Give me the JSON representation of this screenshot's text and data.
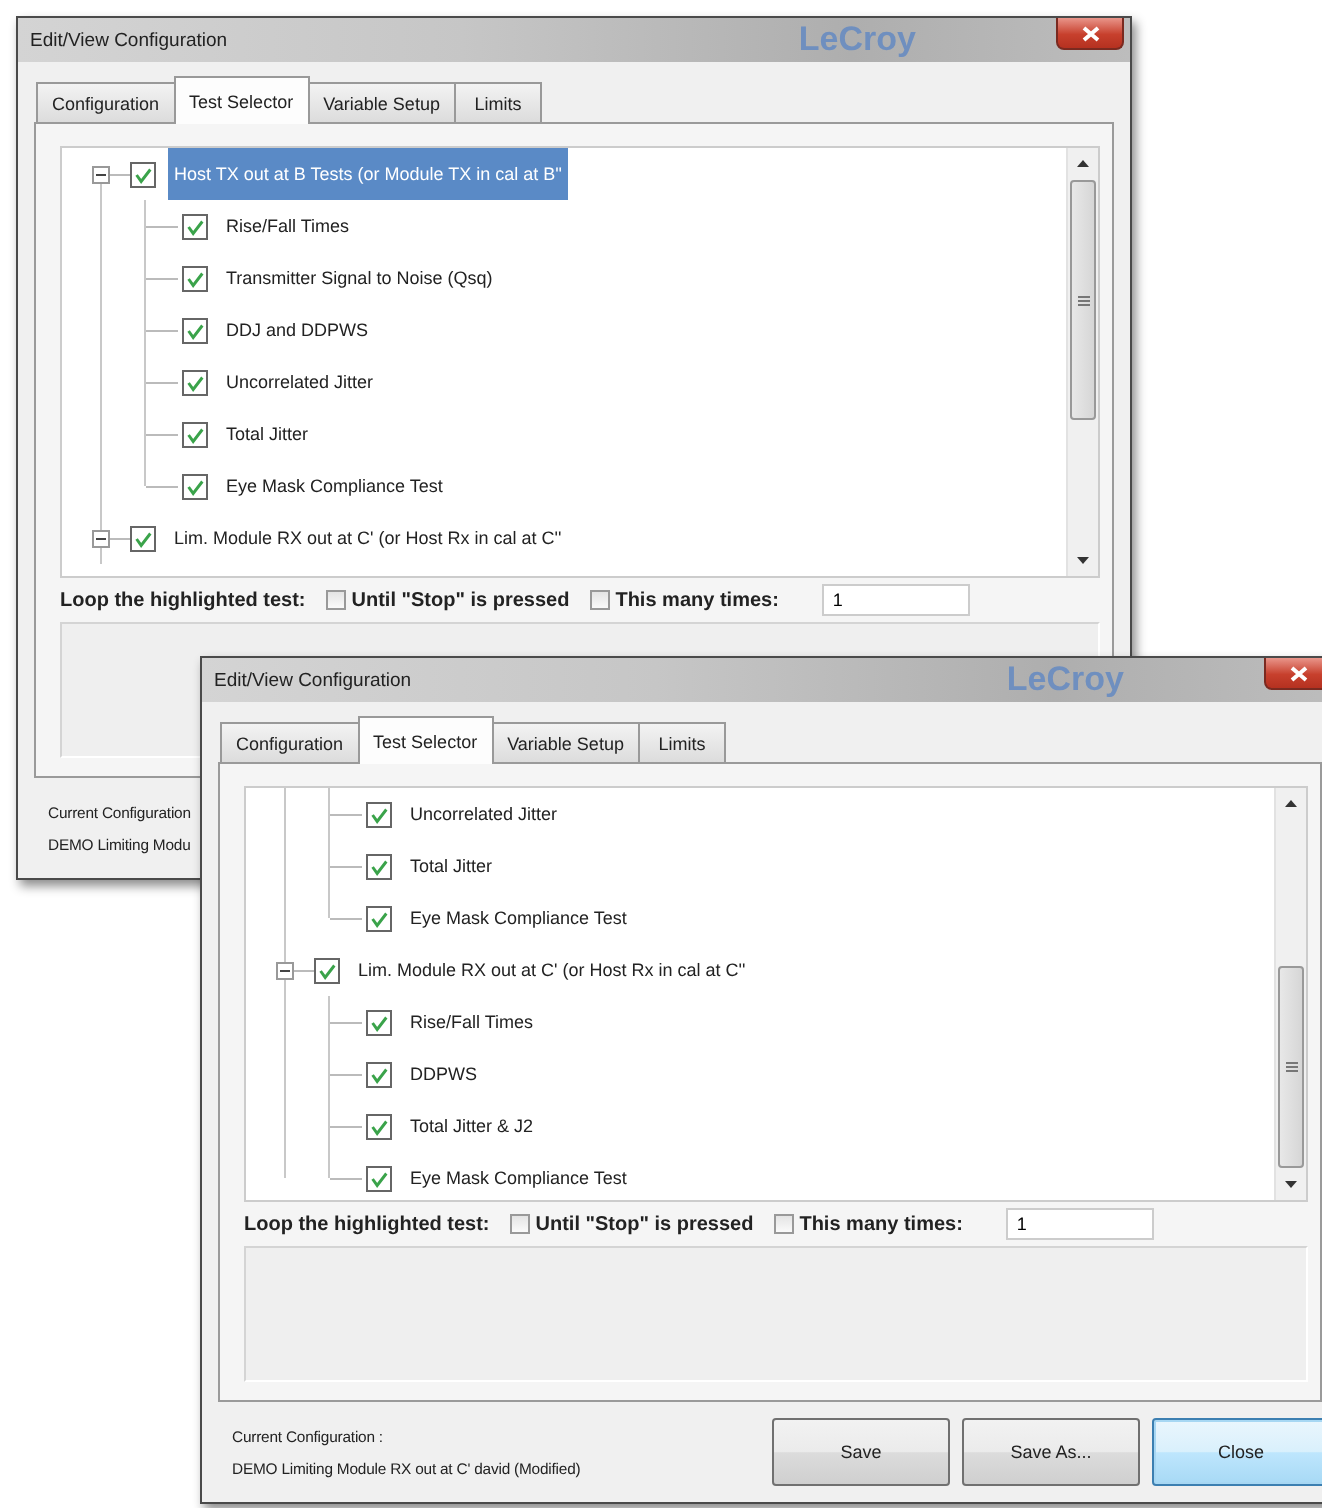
{
  "windows": [
    {
      "title": "Edit/View Configuration",
      "logo": "LeCroy",
      "tabs": [
        {
          "label": "Configuration",
          "selected": false
        },
        {
          "label": "Test Selector",
          "selected": true
        },
        {
          "label": "Variable Setup",
          "selected": false
        },
        {
          "label": "Limits",
          "selected": false
        }
      ],
      "tree": [
        {
          "label": "Host TX out at B Tests (or Module TX in cal at B''",
          "checked": true,
          "selected": true,
          "expanded": true,
          "children": [
            {
              "label": "Rise/Fall Times",
              "checked": true,
              "selected": false
            },
            {
              "label": "Transmitter Signal to Noise (Qsq)",
              "checked": true,
              "selected": false
            },
            {
              "label": "DDJ and DDPWS",
              "checked": true,
              "selected": false
            },
            {
              "label": "Uncorrelated Jitter",
              "checked": true,
              "selected": false
            },
            {
              "label": "Total Jitter",
              "checked": true,
              "selected": false
            },
            {
              "label": "Eye Mask Compliance Test",
              "checked": true,
              "selected": false
            }
          ]
        },
        {
          "label": "Lim. Module RX out at C' (or Host Rx in cal at C''",
          "checked": true,
          "selected": false,
          "expanded": true
        }
      ],
      "loop": {
        "label": "Loop the highlighted test:",
        "options": [
          {
            "label": "Until \"Stop\" is pressed",
            "checked": false
          },
          {
            "label": "This many times:",
            "checked": false
          }
        ],
        "count": "1"
      },
      "footer": {
        "config_label": "Current Configuration",
        "config_value": "DEMO Limiting Modu"
      }
    },
    {
      "title": "Edit/View Configuration",
      "logo": "LeCroy",
      "tabs": [
        {
          "label": "Configuration",
          "selected": false
        },
        {
          "label": "Test Selector",
          "selected": true
        },
        {
          "label": "Variable Setup",
          "selected": false
        },
        {
          "label": "Limits",
          "selected": false
        }
      ],
      "tree": [
        {
          "children": [
            {
              "label": "Uncorrelated Jitter",
              "checked": true,
              "selected": false
            },
            {
              "label": "Total Jitter",
              "checked": true,
              "selected": false
            },
            {
              "label": "Eye Mask Compliance Test",
              "checked": true,
              "selected": false
            }
          ]
        },
        {
          "label": "Lim. Module RX out at C' (or Host Rx in cal at C''",
          "checked": true,
          "selected": false,
          "expanded": true,
          "children": [
            {
              "label": "Rise/Fall Times",
              "checked": true,
              "selected": false
            },
            {
              "label": "DDPWS",
              "checked": true,
              "selected": false
            },
            {
              "label": "Total Jitter & J2",
              "checked": true,
              "selected": false
            },
            {
              "label": "Eye Mask Compliance Test",
              "checked": true,
              "selected": false
            }
          ]
        }
      ],
      "loop": {
        "label": "Loop the highlighted test:",
        "options": [
          {
            "label": "Until \"Stop\" is pressed",
            "checked": false
          },
          {
            "label": "This many times:",
            "checked": false
          }
        ],
        "count": "1"
      },
      "footer": {
        "config_label": "Current Configuration :",
        "config_value": "DEMO Limiting Module RX out at C'  david  (Modified)"
      },
      "buttons": [
        {
          "label": "Save",
          "default": false
        },
        {
          "label": "Save As...",
          "default": false
        },
        {
          "label": "Close",
          "default": true
        }
      ]
    }
  ]
}
